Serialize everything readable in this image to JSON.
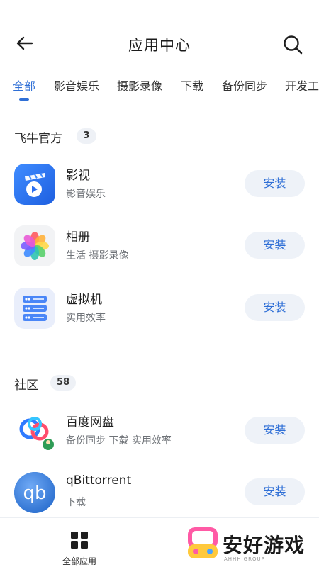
{
  "header": {
    "title": "应用中心"
  },
  "tabs": [
    {
      "label": "全部"
    },
    {
      "label": "影音娱乐"
    },
    {
      "label": "摄影录像"
    },
    {
      "label": "下载"
    },
    {
      "label": "备份同步"
    },
    {
      "label": "开发工具"
    }
  ],
  "sections": {
    "official": {
      "title": "飞牛官方",
      "count": "3",
      "apps": [
        {
          "name": "影视",
          "sub": "影音娱乐",
          "button": "安装",
          "icon": "film-play-icon"
        },
        {
          "name": "相册",
          "sub": "生活 摄影录像",
          "button": "安装",
          "icon": "photo-petal-icon"
        },
        {
          "name": "虚拟机",
          "sub": "实用效率",
          "button": "安装",
          "icon": "server-stack-icon"
        }
      ]
    },
    "community": {
      "title": "社区",
      "count": "58",
      "apps": [
        {
          "name": "百度网盘",
          "sub": "备份同步 下载 实用效率",
          "button": "安装",
          "icon": "baidu-cloud-icon"
        },
        {
          "name": "qBittorrent",
          "sub": "下载",
          "button": "安装",
          "icon": "qbittorrent-icon"
        }
      ]
    }
  },
  "bottom_nav": {
    "all_apps": "全部应用"
  },
  "watermark": {
    "text": "安好游戏",
    "small": "AHHH.GROUP"
  },
  "colors": {
    "accent": "#2f6fd6",
    "button_bg": "#eef2f8",
    "badge_bg": "#eef1f6"
  }
}
